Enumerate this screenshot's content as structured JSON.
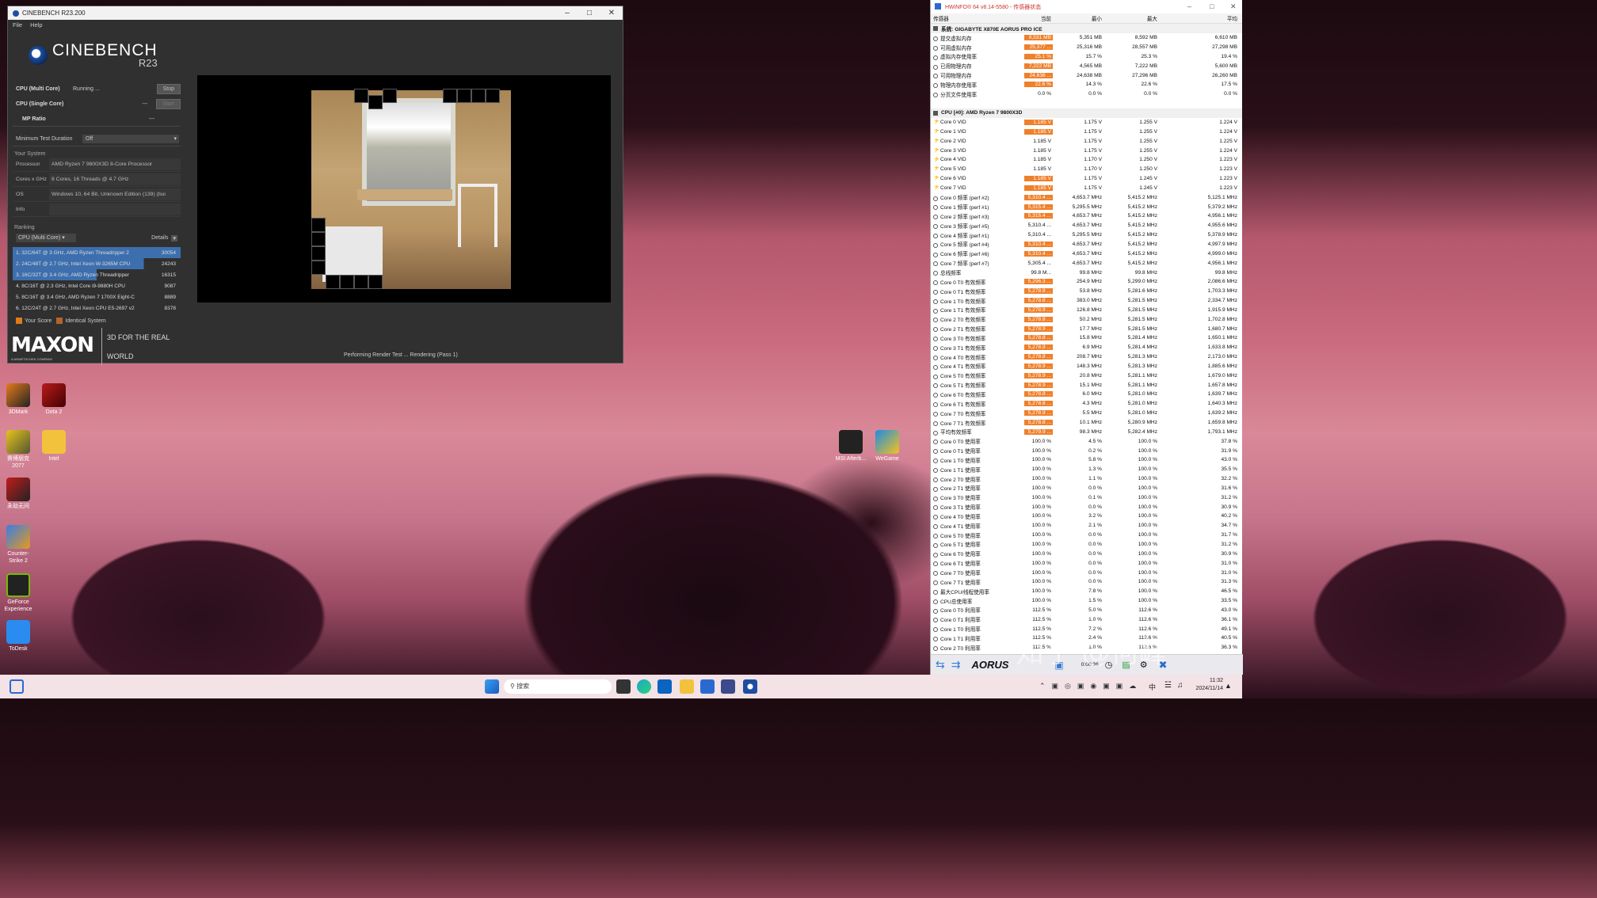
{
  "cinebench": {
    "title": "CINEBENCH R23.200",
    "menu": [
      "File",
      "Help"
    ],
    "logo_main": "CINEBENCH",
    "logo_sub": "R23",
    "multi_label": "CPU (Multi Core)",
    "multi_status": "Running ...",
    "stop_label": "Stop",
    "single_label": "CPU (Single Core)",
    "single_value": "---",
    "start_label": "Start",
    "mp_label": "MP Ratio",
    "mp_value": "---",
    "duration_label": "Minimum Test Duration",
    "duration_value": "Off",
    "your_system": "Your System",
    "system": [
      {
        "k": "Processor",
        "v": "AMD Ryzen 7 9800X3D 8-Core Processor"
      },
      {
        "k": "Cores x GHz",
        "v": "8 Cores, 16 Threads @ 4.7 GHz"
      },
      {
        "k": "OS",
        "v": "Windows 10, 64 Bit, Unknown Edition (139) (bui"
      },
      {
        "k": "Info",
        "v": ""
      }
    ],
    "ranking_label": "Ranking",
    "ranking_select": "CPU (Multi Core)",
    "details_label": "Details",
    "ranking": [
      {
        "n": "1. 32C/64T @ 3 GHz, AMD Ryzen Threadripper 2",
        "s": "30054"
      },
      {
        "n": "2. 24C/48T @ 2.7 GHz, Intel Xeon W-3265M CPU",
        "s": "24243"
      },
      {
        "n": "3. 16C/32T @ 3.4 GHz, AMD Ryzen Threadripper",
        "s": "16315"
      },
      {
        "n": "4. 8C/16T @ 2.3 GHz, Intel Core i9-9880H CPU",
        "s": "9087"
      },
      {
        "n": "5. 8C/16T @ 3.4 GHz, AMD Ryzen 7 1700X Eight-C",
        "s": "8889"
      },
      {
        "n": "6. 12C/24T @ 2.7 GHz, Intel Xeon CPU E5-2697 v2",
        "s": "8378"
      }
    ],
    "legend_your": "Your Score",
    "legend_identical": "Identical System",
    "maxon": "MAXON",
    "maxon_sub": "A NEMETSCHEK COMPANY",
    "tagline": "3D FOR THE REAL WORLD",
    "status": "Performing Render Test ... Rendering (Pass 1)"
  },
  "hwinfo": {
    "title": "HWiNFO® 64 v8.14-5580 - 传感器状态",
    "headers": [
      "传感器",
      "当前",
      "最小",
      "最大",
      "平均"
    ],
    "group1": "系统: GIGABYTE X870E AORUS PRO ICE",
    "rows1": [
      [
        "提交虚拟内存",
        "8,531 MB",
        "5,351 MB",
        "8,592 MB",
        "6,610 MB",
        1
      ],
      [
        "可用虚拟内存",
        "25,377 ...",
        "25,316 MB",
        "28,557 MB",
        "27,298 MB",
        1
      ],
      [
        "虚拟内存使用率",
        "25.1 %",
        "15.7 %",
        "25.3 %",
        "19.4 %",
        1
      ],
      [
        "已用物理内存",
        "7,222 MB",
        "4,565 MB",
        "7,222 MB",
        "5,600 MB",
        1
      ],
      [
        "可用物理内存",
        "24,638 ...",
        "24,638 MB",
        "27,296 MB",
        "26,260 MB",
        1
      ],
      [
        "物理内存使用率",
        "22.6 %",
        "14.3 %",
        "22.6 %",
        "17.5 %",
        1
      ],
      [
        "分页文件使用率",
        "0.0 %",
        "0.0 %",
        "0.0 %",
        "0.0 %",
        0
      ]
    ],
    "group2": "CPU [#0]: AMD Ryzen 7 9800X3D",
    "rows2": [
      [
        "Core 0 VID",
        "1.185 V",
        "1.175 V",
        "1.255 V",
        "1.224 V",
        1,
        "b"
      ],
      [
        "Core 1 VID",
        "1.185 V",
        "1.175 V",
        "1.255 V",
        "1.224 V",
        1,
        "b"
      ],
      [
        "Core 2 VID",
        "1.185 V",
        "1.175 V",
        "1.255 V",
        "1.225 V",
        0,
        "b"
      ],
      [
        "Core 3 VID",
        "1.185 V",
        "1.175 V",
        "1.255 V",
        "1.224 V",
        0,
        "b"
      ],
      [
        "Core 4 VID",
        "1.185 V",
        "1.170 V",
        "1.250 V",
        "1.223 V",
        0,
        "b"
      ],
      [
        "Core 5 VID",
        "1.185 V",
        "1.170 V",
        "1.250 V",
        "1.223 V",
        0,
        "b"
      ],
      [
        "Core 6 VID",
        "1.185 V",
        "1.175 V",
        "1.245 V",
        "1.223 V",
        1,
        "b"
      ],
      [
        "Core 7 VID",
        "1.185 V",
        "1.175 V",
        "1.245 V",
        "1.223 V",
        1,
        "b"
      ],
      [
        "Core 0 频率 (perf #2)",
        "5,310.4 ...",
        "4,653.7 MHz",
        "5,415.2 MHz",
        "5,125.1 MHz",
        1,
        "c"
      ],
      [
        "Core 1 频率 (perf #1)",
        "5,315.4 ...",
        "5,295.5 MHz",
        "5,415.2 MHz",
        "5,379.2 MHz",
        1,
        "c"
      ],
      [
        "Core 2 频率 (perf #3)",
        "5,315.4 ...",
        "4,653.7 MHz",
        "5,415.2 MHz",
        "4,956.1 MHz",
        1,
        "c"
      ],
      [
        "Core 3 频率 (perf #5)",
        "5,310.4 ...",
        "4,653.7 MHz",
        "5,415.2 MHz",
        "4,955.6 MHz",
        0,
        "c"
      ],
      [
        "Core 4 频率 (perf #1)",
        "5,310.4 ...",
        "5,295.5 MHz",
        "5,415.2 MHz",
        "5,378.9 MHz",
        0,
        "c"
      ],
      [
        "Core 5 频率 (perf #4)",
        "5,310.4 ...",
        "4,653.7 MHz",
        "5,415.2 MHz",
        "4,997.9 MHz",
        1,
        "c"
      ],
      [
        "Core 6 频率 (perf #6)",
        "5,310.4 ...",
        "4,653.7 MHz",
        "5,415.2 MHz",
        "4,999.0 MHz",
        1,
        "c"
      ],
      [
        "Core 7 频率 (perf #7)",
        "5,305.4 ...",
        "4,653.7 MHz",
        "5,415.2 MHz",
        "4,956.1 MHz",
        0,
        "c"
      ],
      [
        "总线频率",
        "99.8 M...",
        "99.8 MHz",
        "99.8 MHz",
        "99.8 MHz",
        0,
        "c"
      ],
      [
        "Core 0 T0 有效频率",
        "5,296.3 ...",
        "254.9 MHz",
        "5,299.0 MHz",
        "2,086.6 MHz",
        1,
        "c"
      ],
      [
        "Core 0 T1 有效频率",
        "5,278.8 ...",
        "53.8 MHz",
        "5,281.6 MHz",
        "1,703.3 MHz",
        1,
        "c"
      ],
      [
        "Core 1 T0 有效频率",
        "5,278.8 ...",
        "383.0 MHz",
        "5,281.5 MHz",
        "2,334.7 MHz",
        1,
        "c"
      ],
      [
        "Core 1 T1 有效频率",
        "5,278.9 ...",
        "126.8 MHz",
        "5,281.5 MHz",
        "1,915.9 MHz",
        1,
        "c"
      ],
      [
        "Core 2 T0 有效频率",
        "5,278.8 ...",
        "50.2 MHz",
        "5,281.5 MHz",
        "1,702.8 MHz",
        1,
        "c"
      ],
      [
        "Core 2 T1 有效频率",
        "5,278.9 ...",
        "17.7 MHz",
        "5,281.5 MHz",
        "1,680.7 MHz",
        1,
        "c"
      ],
      [
        "Core 3 T0 有效频率",
        "5,278.8 ...",
        "15.8 MHz",
        "5,281.4 MHz",
        "1,650.1 MHz",
        1,
        "c"
      ],
      [
        "Core 3 T1 有效频率",
        "5,278.9 ...",
        "6.9 MHz",
        "5,281.4 MHz",
        "1,633.8 MHz",
        1,
        "c"
      ],
      [
        "Core 4 T0 有效频率",
        "5,278.8 ...",
        "208.7 MHz",
        "5,281.3 MHz",
        "2,173.0 MHz",
        1,
        "c"
      ],
      [
        "Core 4 T1 有效频率",
        "5,278.9 ...",
        "148.3 MHz",
        "5,281.3 MHz",
        "1,885.6 MHz",
        1,
        "c"
      ],
      [
        "Core 5 T0 有效频率",
        "5,278.9 ...",
        "20.8 MHz",
        "5,281.1 MHz",
        "1,679.0 MHz",
        1,
        "c"
      ],
      [
        "Core 5 T1 有效频率",
        "5,278.9 ...",
        "15.1 MHz",
        "5,281.1 MHz",
        "1,657.8 MHz",
        1,
        "c"
      ],
      [
        "Core 6 T0 有效频率",
        "5,278.8 ...",
        "6.0 MHz",
        "5,281.0 MHz",
        "1,639.7 MHz",
        1,
        "c"
      ],
      [
        "Core 6 T1 有效频率",
        "5,278.8 ...",
        "4.3 MHz",
        "5,281.0 MHz",
        "1,640.3 MHz",
        1,
        "c"
      ],
      [
        "Core 7 T0 有效频率",
        "5,278.9 ...",
        "5.5 MHz",
        "5,281.0 MHz",
        "1,639.2 MHz",
        1,
        "c"
      ],
      [
        "Core 7 T1 有效频率",
        "5,278.8 ...",
        "10.1 MHz",
        "5,280.9 MHz",
        "1,659.8 MHz",
        1,
        "c"
      ],
      [
        "平均有效频率",
        "5,279.9 ...",
        "98.3 MHz",
        "5,282.4 MHz",
        "1,793.1 MHz",
        1,
        "c"
      ],
      [
        "Core 0 T0 使用率",
        "100.0 %",
        "4.5 %",
        "100.0 %",
        "37.8 %",
        0,
        "c"
      ],
      [
        "Core 0 T1 使用率",
        "100.0 %",
        "0.2 %",
        "100.0 %",
        "31.9 %",
        0,
        "c"
      ],
      [
        "Core 1 T0 使用率",
        "100.0 %",
        "5.8 %",
        "100.0 %",
        "43.0 %",
        0,
        "c"
      ],
      [
        "Core 1 T1 使用率",
        "100.0 %",
        "1.3 %",
        "100.0 %",
        "35.5 %",
        0,
        "c"
      ],
      [
        "Core 2 T0 使用率",
        "100.0 %",
        "1.1 %",
        "100.0 %",
        "32.2 %",
        0,
        "c"
      ],
      [
        "Core 2 T1 使用率",
        "100.0 %",
        "0.0 %",
        "100.0 %",
        "31.6 %",
        0,
        "c"
      ],
      [
        "Core 3 T0 使用率",
        "100.0 %",
        "0.1 %",
        "100.0 %",
        "31.2 %",
        0,
        "c"
      ],
      [
        "Core 3 T1 使用率",
        "100.0 %",
        "0.0 %",
        "100.0 %",
        "30.9 %",
        0,
        "c"
      ],
      [
        "Core 4 T0 使用率",
        "100.0 %",
        "3.2 %",
        "100.0 %",
        "40.2 %",
        0,
        "c"
      ],
      [
        "Core 4 T1 使用率",
        "100.0 %",
        "2.1 %",
        "100.0 %",
        "34.7 %",
        0,
        "c"
      ],
      [
        "Core 5 T0 使用率",
        "100.0 %",
        "0.0 %",
        "100.0 %",
        "31.7 %",
        0,
        "c"
      ],
      [
        "Core 5 T1 使用率",
        "100.0 %",
        "0.0 %",
        "100.0 %",
        "31.2 %",
        0,
        "c"
      ],
      [
        "Core 6 T0 使用率",
        "100.0 %",
        "0.0 %",
        "100.0 %",
        "30.9 %",
        0,
        "c"
      ],
      [
        "Core 6 T1 使用率",
        "100.0 %",
        "0.0 %",
        "100.0 %",
        "31.0 %",
        0,
        "c"
      ],
      [
        "Core 7 T0 使用率",
        "100.0 %",
        "0.0 %",
        "100.0 %",
        "31.0 %",
        0,
        "c"
      ],
      [
        "Core 7 T1 使用率",
        "100.0 %",
        "0.0 %",
        "100.0 %",
        "31.3 %",
        0,
        "c"
      ],
      [
        "最大CPU/线程使用率",
        "100.0 %",
        "7.8 %",
        "100.0 %",
        "46.5 %",
        0,
        "c"
      ],
      [
        "CPU总使用率",
        "100.0 %",
        "1.5 %",
        "100.0 %",
        "33.5 %",
        0,
        "c"
      ],
      [
        "Core 0 T0 利用率",
        "112.5 %",
        "5.0 %",
        "112.6 %",
        "43.0 %",
        0,
        "c"
      ],
      [
        "Core 0 T1 利用率",
        "112.5 %",
        "1.0 %",
        "112.6 %",
        "36.1 %",
        0,
        "c"
      ],
      [
        "Core 1 T0 利用率",
        "112.5 %",
        "7.2 %",
        "112.6 %",
        "49.1 %",
        0,
        "c"
      ],
      [
        "Core 1 T1 利用率",
        "112.5 %",
        "2.4 %",
        "112.6 %",
        "40.5 %",
        0,
        "c"
      ],
      [
        "Core 2 T0 利用率",
        "112.5 %",
        "1.0 %",
        "112.6 %",
        "36.3 %",
        0,
        "c"
      ]
    ],
    "timer": "0:00:36",
    "brand": "AORUS"
  },
  "desktop": {
    "icons": [
      "3DMark",
      "Dota 2",
      "赛博朋克 2077",
      "Intel",
      "永劫无间",
      "Counter-Strike 2",
      "GeForce Experience",
      "ToDesk",
      "MSI Afterb...",
      "WeGame"
    ],
    "watermark": "知乎 @何峰"
  },
  "taskbar": {
    "search_placeholder": "搜索",
    "time": "11:32",
    "date": "2024/11/14",
    "lang": "中"
  }
}
